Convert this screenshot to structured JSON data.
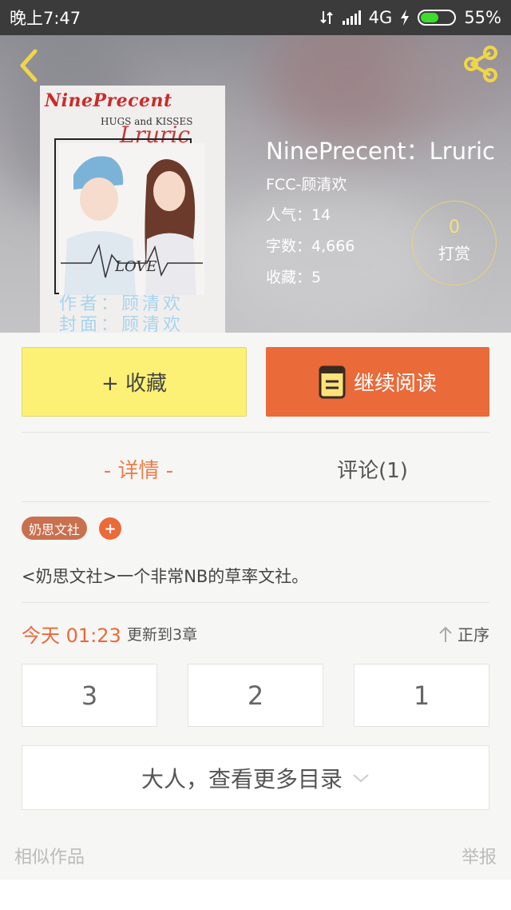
{
  "status_bar": {
    "time": "晚上7:47",
    "network": "4G",
    "battery": "55%",
    "battery_level": 0.55
  },
  "header": {
    "back_icon": "chevron-left-icon",
    "share_icon": "share-icon",
    "accent_color": "#f0d54a"
  },
  "cover": {
    "title": "NinePrecent",
    "subtitle": "HUGS and KISSES",
    "script": "Lruric",
    "art_text": "LOVE",
    "credit_line1": "作者：顾清欢",
    "credit_line2": "封面：顾清欢"
  },
  "book": {
    "title": "NinePrecent：Lruric",
    "author": "FCC-顾清欢",
    "popularity": "人气：14",
    "word_count": "字数：4,666",
    "favorites": "收藏：5"
  },
  "tip": {
    "count": "0",
    "label": "打赏"
  },
  "actions": {
    "collect": "+ 收藏",
    "read": "继续阅读",
    "read_color": "#ea6a39",
    "collect_color": "#fcf174"
  },
  "tabs": {
    "details": "- 详情 -",
    "comments": "评论(1)"
  },
  "tag": {
    "label": "奶思文社",
    "add": "+"
  },
  "description": "<奶思文社>一个非常NB的草率文社。",
  "update": {
    "time": "今天 01:23",
    "text": "更新到3章",
    "sort": "正序"
  },
  "chapters": [
    "3",
    "2",
    "1"
  ],
  "more_catalog": "大人，查看更多目录",
  "footer": {
    "similar": "相似作品",
    "report": "举报"
  }
}
